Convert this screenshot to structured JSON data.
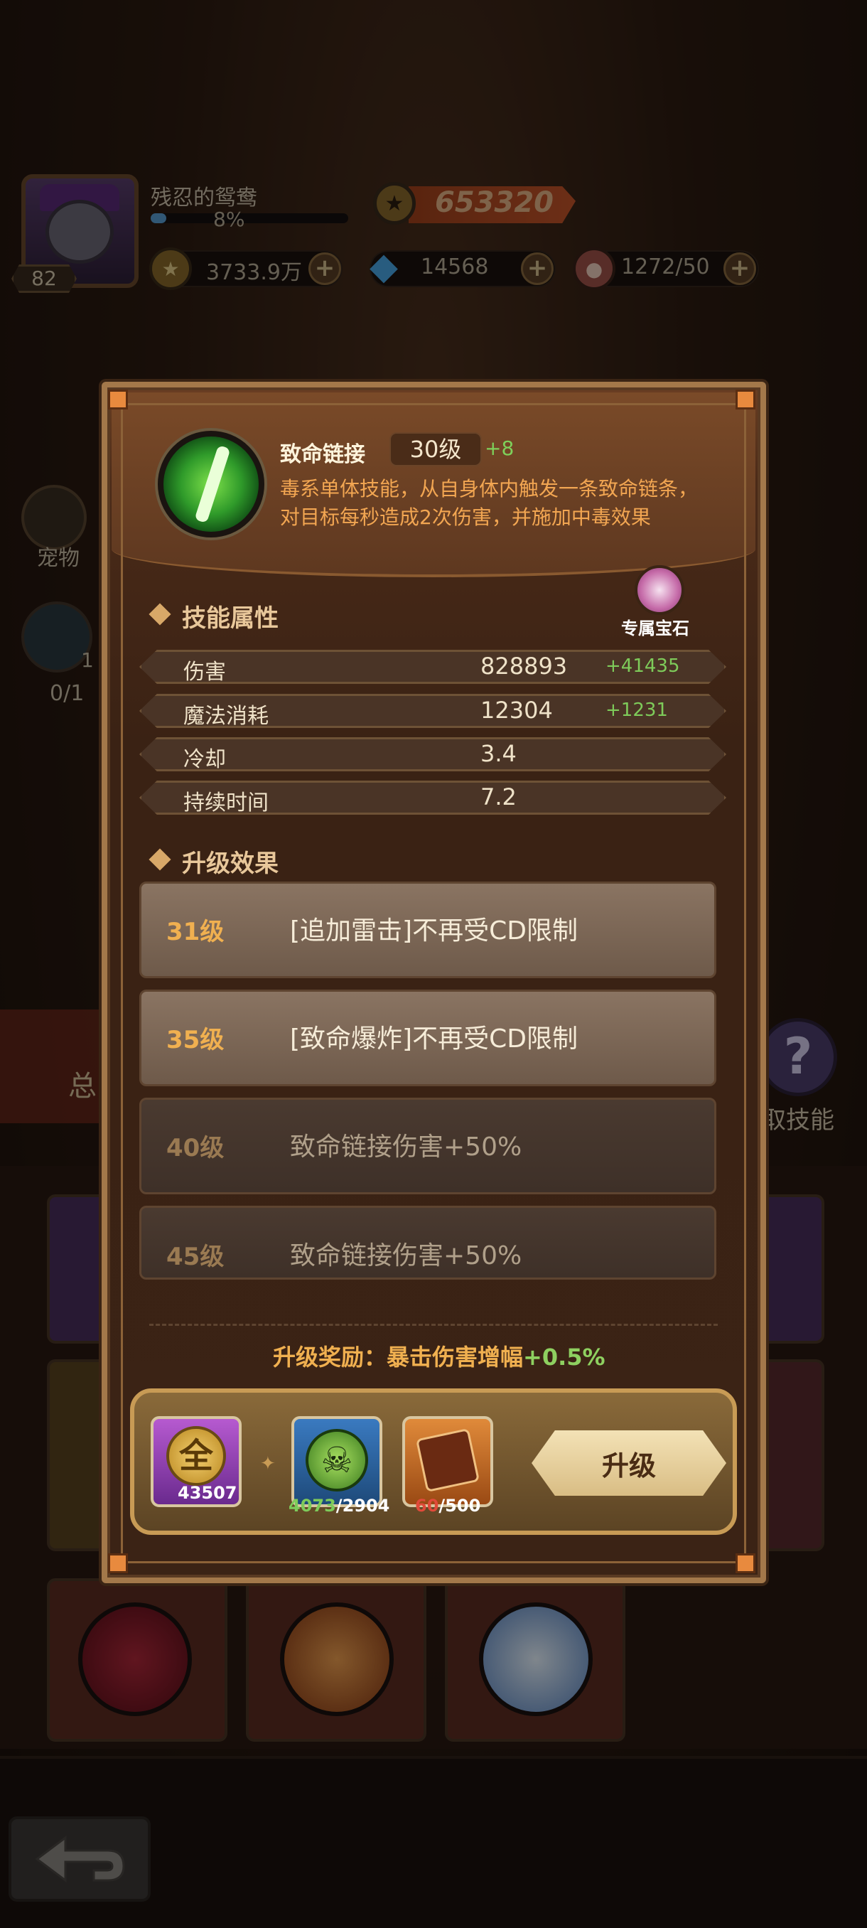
{
  "player": {
    "name": "残忍的鸳鸯",
    "level": "82",
    "xp_text": "8%",
    "xp_fraction": 0.08,
    "power": "653320"
  },
  "resources": {
    "gold": "3733.9万",
    "diamond": "14568",
    "meat": "1272/50"
  },
  "side": {
    "pet_label": "宠物",
    "fish_count": "0/1",
    "fish_small": "1",
    "left_tab": "总",
    "right_label": "取技能"
  },
  "skill": {
    "name": "致命链接",
    "level": "30级",
    "bonus": "+8",
    "desc_line1": "毒系单体技能，从自身体内触发一条致命链条，",
    "desc_line2": "对目标每秒造成2次伤害，并施加中毒效果"
  },
  "attributes": {
    "title": "技能属性",
    "gem_label": "专属宝石",
    "rows": [
      {
        "name": "伤害",
        "value": "828893",
        "bonus": "+41435"
      },
      {
        "name": "魔法消耗",
        "value": "12304",
        "bonus": "+1231"
      },
      {
        "name": "冷却",
        "value": "3.4",
        "bonus": ""
      },
      {
        "name": "持续时间",
        "value": "7.2",
        "bonus": ""
      }
    ]
  },
  "upgrades": {
    "title": "升级效果",
    "rows": [
      {
        "level": "31级",
        "text": "[追加雷击]不再受CD限制"
      },
      {
        "level": "35级",
        "text": "[致命爆炸]不再受CD限制"
      },
      {
        "level": "40级",
        "text": "致命链接伤害+50%"
      },
      {
        "level": "45级",
        "text": "致命链接伤害+50%"
      }
    ]
  },
  "reward": {
    "label": "升级奖励：暴击伤害增幅",
    "value": "+0.5%"
  },
  "costs": {
    "gold_symbol": "全",
    "gold_amount": "43507",
    "poison_have": "4073",
    "poison_need": "/2904",
    "book_have": "60",
    "book_need": "/500"
  },
  "upgrade_button": "升级",
  "colors": {
    "accent_green": "#7ecb5a",
    "desc_orange": "#f2a652",
    "insufficient_red": "#e04a3a"
  }
}
